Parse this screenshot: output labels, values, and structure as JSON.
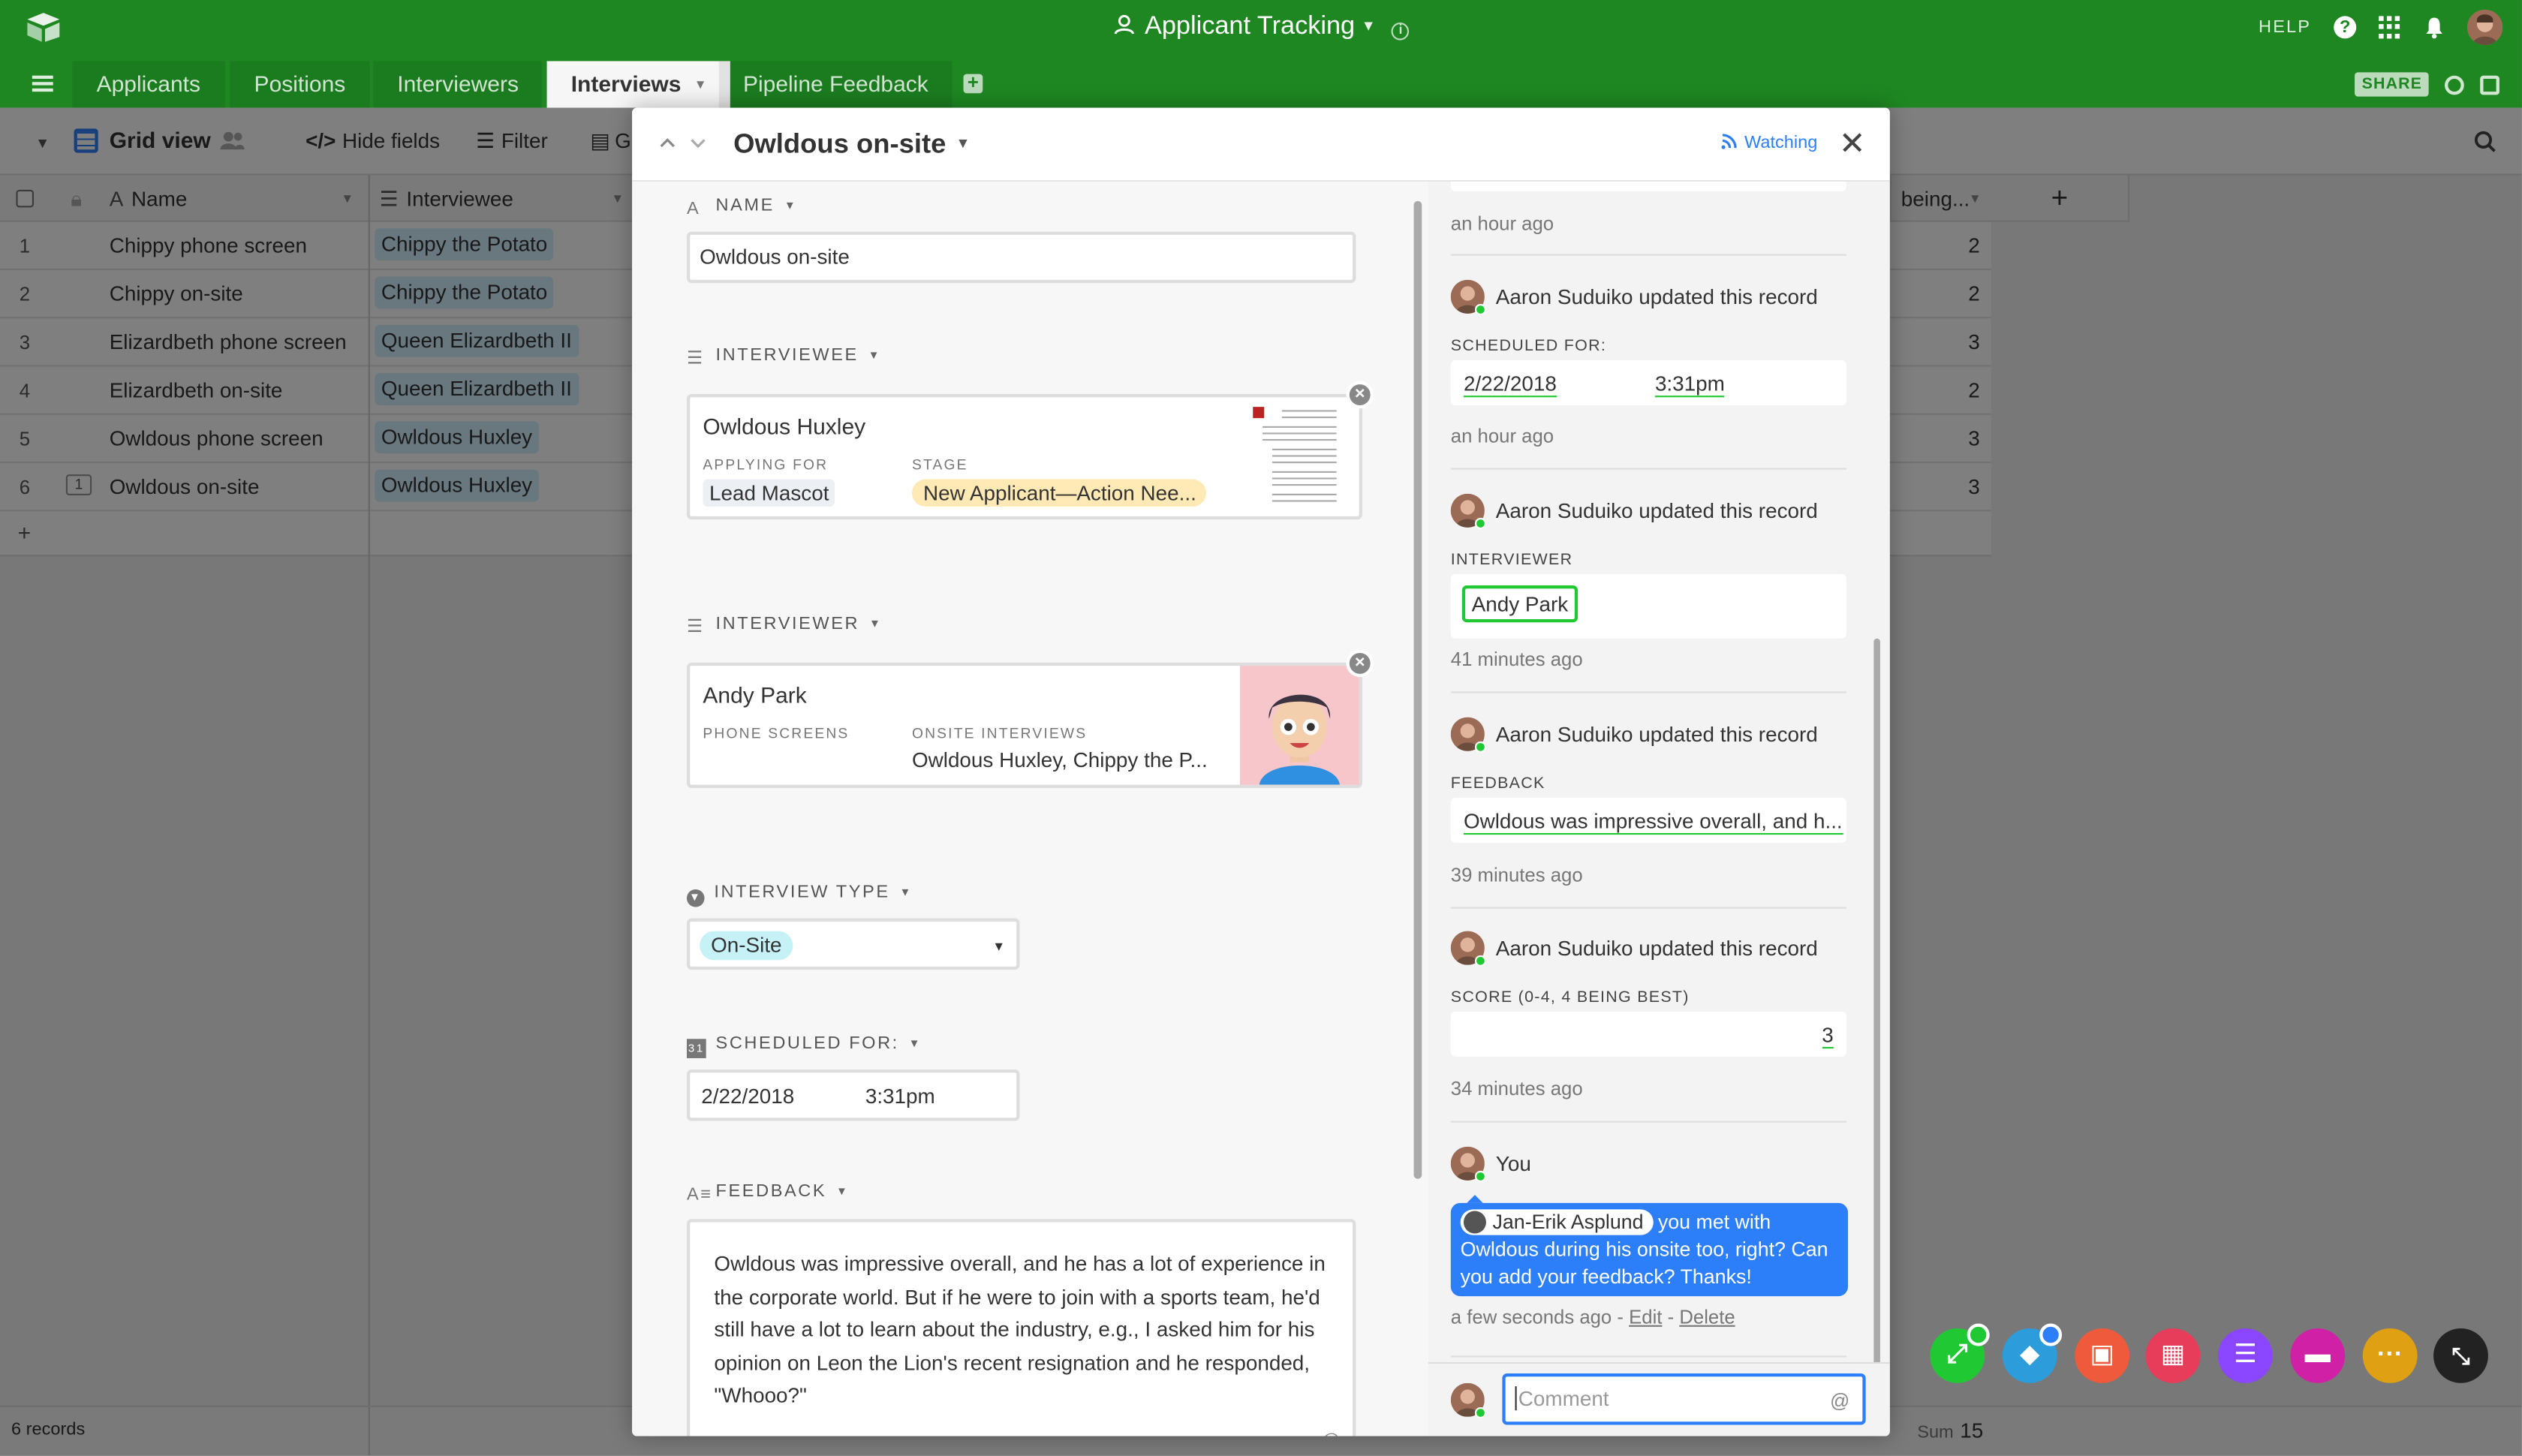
{
  "app": {
    "base_title": "Applicant Tracking",
    "help_label": "HELP",
    "share_label": "SHARE"
  },
  "tabs": [
    {
      "label": "Applicants"
    },
    {
      "label": "Positions"
    },
    {
      "label": "Interviewers"
    },
    {
      "label": "Interviews"
    },
    {
      "label": "Pipeline Feedback"
    }
  ],
  "viewbar": {
    "view_name": "Grid view",
    "hide_fields": "Hide fields",
    "filter": "Filter",
    "group_partial": "G"
  },
  "grid": {
    "col_name": "Name",
    "col_interviewee": "Interviewee",
    "col_score_partial": "being...",
    "rows": [
      {
        "num": "1",
        "name": "Chippy phone screen",
        "interviewee": "Chippy the Potato",
        "score": "2"
      },
      {
        "num": "2",
        "name": "Chippy on-site",
        "interviewee": "Chippy the Potato",
        "score": "2"
      },
      {
        "num": "3",
        "name": "Elizardbeth phone screen",
        "interviewee": "Queen Elizardbeth II",
        "score": "3"
      },
      {
        "num": "4",
        "name": "Elizardbeth on-site",
        "interviewee": "Queen Elizardbeth II",
        "score": "2"
      },
      {
        "num": "5",
        "name": "Owldous phone screen",
        "interviewee": "Owldous Huxley",
        "score": "3"
      },
      {
        "num": "6",
        "name": "Owldous on-site",
        "interviewee": "Owldous Huxley",
        "score": "3",
        "comments": "1"
      }
    ],
    "records_count": "6 records",
    "sum_label": "Sum",
    "sum_value": "15"
  },
  "modal": {
    "title": "Owldous on-site",
    "watching": "Watching",
    "fields": {
      "name_label": "NAME",
      "name_value": "Owldous on-site",
      "interviewee_label": "INTERVIEWEE",
      "interviewee_card": {
        "title": "Owldous Huxley",
        "applying_for_label": "APPLYING FOR",
        "applying_for_value": "Lead Mascot",
        "stage_label": "STAGE",
        "stage_value": "New Applicant—Action Nee..."
      },
      "interviewer_label": "INTERVIEWER",
      "interviewer_card": {
        "title": "Andy Park",
        "phone_label": "PHONE SCREENS",
        "onsite_label": "ONSITE INTERVIEWS",
        "onsite_value": "Owldous Huxley, Chippy the P..."
      },
      "type_label": "INTERVIEW TYPE",
      "type_value": "On-Site",
      "scheduled_label": "SCHEDULED FOR:",
      "scheduled_date": "2/22/2018",
      "scheduled_time": "3:31pm",
      "feedback_label": "FEEDBACK",
      "feedback_value": "Owldous was impressive overall, and he has a lot of experience in the corporate world. But if he were to join with a sports team, he'd still have a lot to learn about the industry, e.g., I asked him for his opinion on Leon the Lion's recent resignation and he responded, \"Whooo?\""
    },
    "activity": {
      "top_time": "an hour ago",
      "entries": [
        {
          "user": "Aaron Suduiko updated this record",
          "field": "SCHEDULED FOR:",
          "date": "2/22/2018",
          "time_val": "3:31pm",
          "time": "an hour ago"
        },
        {
          "user": "Aaron Suduiko updated this record",
          "field": "INTERVIEWER",
          "value": "Andy Park",
          "time": "41 minutes ago"
        },
        {
          "user": "Aaron Suduiko updated this record",
          "field": "FEEDBACK",
          "value": "Owldous was impressive overall, and h...",
          "time": "39 minutes ago"
        },
        {
          "user": "Aaron Suduiko updated this record",
          "field": "SCORE (0-4, 4 BEING BEST)",
          "value": "3",
          "time": "34 minutes ago"
        }
      ],
      "comment": {
        "user": "You",
        "mention": "Jan-Erik Asplund",
        "text": "you met with Owldous during his onsite too, right? Can you add your feedback? Thanks!",
        "time": "a few seconds ago",
        "edit": "Edit",
        "delete": "Delete"
      },
      "comment_placeholder": "Comment"
    }
  },
  "colors": {
    "brand_green": "#1e8722",
    "accent_blue": "#2d7ff9",
    "chip_blue": "#d0f0fd",
    "stage_yellow": "#ffeab6"
  }
}
